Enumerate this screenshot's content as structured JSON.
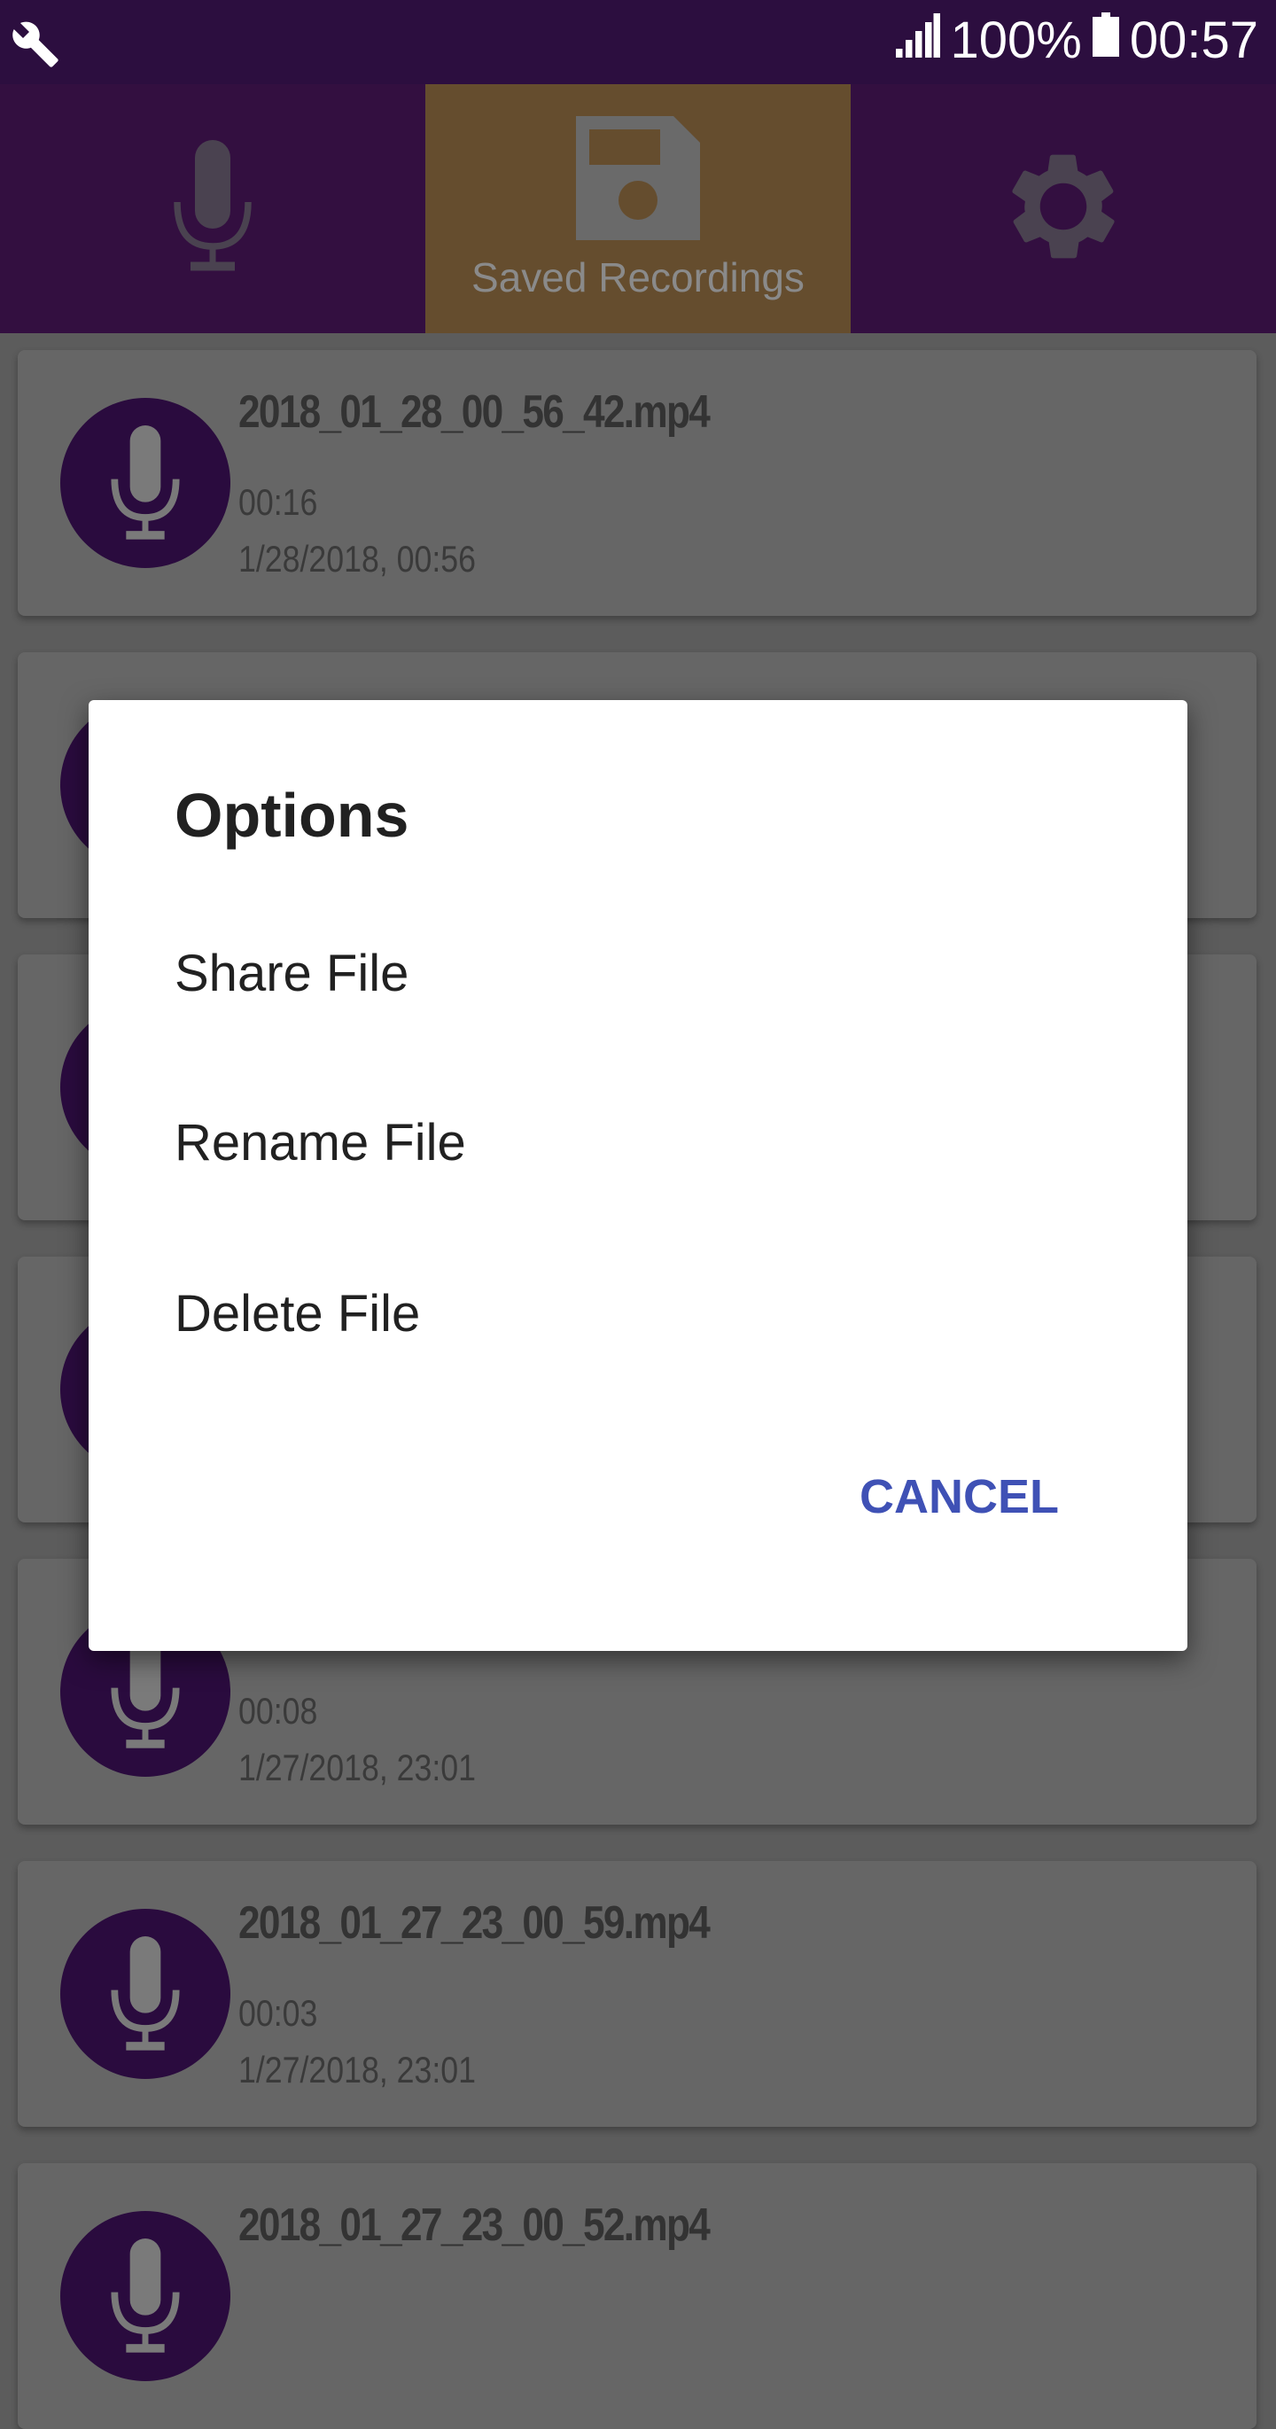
{
  "status_bar": {
    "battery": "100%",
    "time": "00:57",
    "icons": [
      "wrench-icon",
      "signal-icon",
      "battery-icon"
    ]
  },
  "tabs": [
    {
      "icon": "microphone-icon",
      "label": ""
    },
    {
      "icon": "floppy-disk-icon",
      "label": "Saved Recordings",
      "active": true
    },
    {
      "icon": "gear-icon",
      "label": ""
    }
  ],
  "recordings": [
    {
      "title": "2018_01_28_00_56_42.mp4",
      "duration": "00:16",
      "date": "1/28/2018, 00:56"
    },
    {
      "title": "",
      "duration": "",
      "date": ""
    },
    {
      "title": "",
      "duration": "",
      "date": ""
    },
    {
      "title": "",
      "duration": "",
      "date": ""
    },
    {
      "title": "",
      "duration": "00:08",
      "date": "1/27/2018, 23:01"
    },
    {
      "title": "2018_01_27_23_00_59.mp4",
      "duration": "00:03",
      "date": "1/27/2018, 23:01"
    },
    {
      "title": "2018_01_27_23_00_52.mp4",
      "duration": "",
      "date": ""
    }
  ],
  "dialog": {
    "title": "Options",
    "items": [
      "Share File",
      "Rename File",
      "Delete File"
    ],
    "cancel": "CANCEL"
  },
  "colors": {
    "primary": "#7b1fa2",
    "accent": "#ff9c2e",
    "dialog_button": "#3f51b5"
  }
}
